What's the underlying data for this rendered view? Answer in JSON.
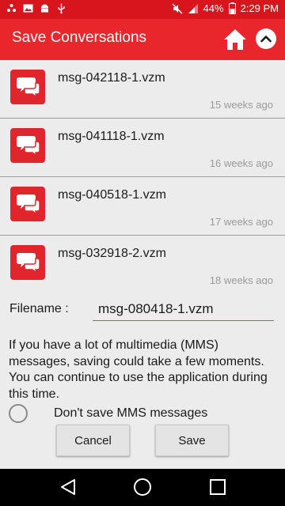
{
  "status_bar": {
    "battery_percent": "44%",
    "time": "2:29 PM",
    "icons": [
      "more-notifications-icon",
      "image-notification-icon",
      "android-notification-icon",
      "usb-icon",
      "mute-icon",
      "signal-icon",
      "battery-icon"
    ]
  },
  "app_bar": {
    "title": "Save Conversations",
    "home_icon": "home-icon",
    "up_icon": "chevron-up-icon"
  },
  "files": [
    {
      "name": "msg-042118-1.vzm",
      "date": "15 weeks ago"
    },
    {
      "name": "msg-041118-1.vzm",
      "date": "16 weeks ago"
    },
    {
      "name": "msg-040518-1.vzm",
      "date": "17 weeks ago"
    },
    {
      "name": "msg-032918-2.vzm",
      "date": "18 weeks ago"
    }
  ],
  "form": {
    "filename_label": "Filename :",
    "filename_value": "msg-080418-1.vzm",
    "info_text": "If you have a lot of multimedia (MMS) messages, saving could take a few moments. You can continue to use the application during this time.",
    "mms_option_label": "Don't save MMS messages",
    "mms_option_checked": false,
    "cancel_label": "Cancel",
    "save_label": "Save"
  },
  "colors": {
    "status_bar": "#d8141c",
    "app_bar": "#e8262c",
    "accent_input_underline": "#2b8fc6",
    "background": "#ececec"
  }
}
